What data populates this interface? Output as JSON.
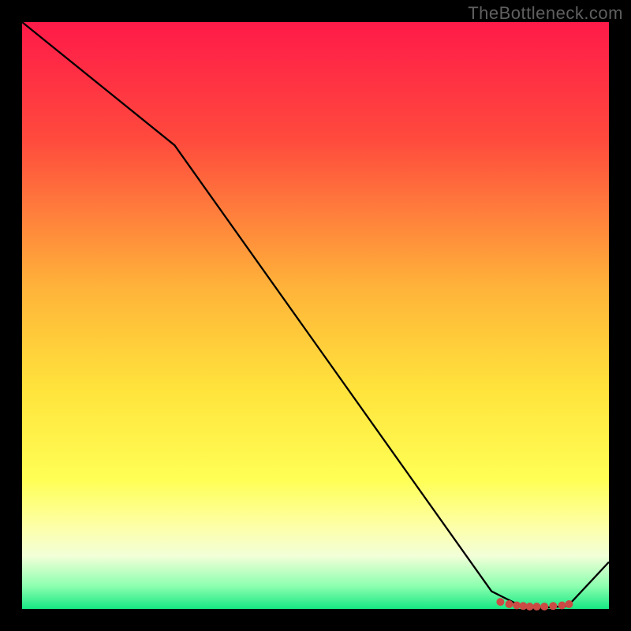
{
  "watermark": "TheBottleneck.com",
  "chart_data": {
    "type": "line",
    "title": "",
    "xlabel": "",
    "ylabel": "",
    "xlim": [
      0,
      100
    ],
    "ylim": [
      0,
      100
    ],
    "background_gradient": {
      "stops": [
        {
          "offset": 0,
          "color": "#ff1a49"
        },
        {
          "offset": 20,
          "color": "#ff4a3d"
        },
        {
          "offset": 45,
          "color": "#ffb23a"
        },
        {
          "offset": 62,
          "color": "#ffe23b"
        },
        {
          "offset": 78,
          "color": "#ffff55"
        },
        {
          "offset": 86,
          "color": "#fdffa8"
        },
        {
          "offset": 91,
          "color": "#f2ffd8"
        },
        {
          "offset": 96,
          "color": "#8fffb0"
        },
        {
          "offset": 100,
          "color": "#17e884"
        }
      ]
    },
    "series": [
      {
        "name": "curve",
        "points": [
          {
            "x": 0,
            "y": 100
          },
          {
            "x": 26,
            "y": 79
          },
          {
            "x": 80,
            "y": 3
          },
          {
            "x": 86,
            "y": 0
          },
          {
            "x": 93,
            "y": 0.5
          },
          {
            "x": 100,
            "y": 8
          }
        ]
      }
    ],
    "markers": [
      {
        "x": 81.5,
        "y": 1.2
      },
      {
        "x": 83.0,
        "y": 0.8
      },
      {
        "x": 84.3,
        "y": 0.6
      },
      {
        "x": 85.4,
        "y": 0.5
      },
      {
        "x": 86.5,
        "y": 0.4
      },
      {
        "x": 87.7,
        "y": 0.4
      },
      {
        "x": 89.0,
        "y": 0.4
      },
      {
        "x": 90.5,
        "y": 0.5
      },
      {
        "x": 92.0,
        "y": 0.6
      },
      {
        "x": 93.2,
        "y": 0.8
      }
    ]
  }
}
